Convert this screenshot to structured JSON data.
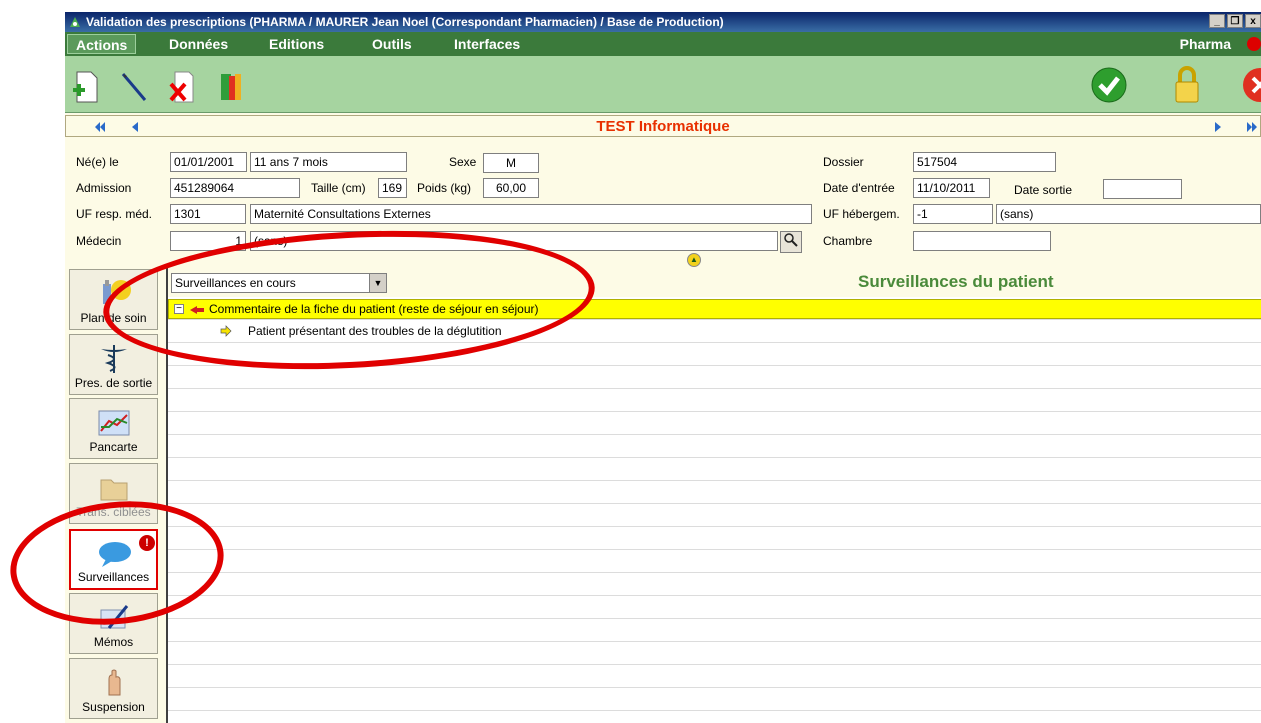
{
  "window": {
    "title": "Validation des prescriptions (PHARMA / MAURER Jean Noel (Correspondant Pharmacien) / Base de Production)",
    "buttons": {
      "minimize": "_",
      "maximize": "×",
      "close": "x"
    }
  },
  "menu": {
    "items": [
      {
        "label": "Actions",
        "active": true
      },
      {
        "label": "Données"
      },
      {
        "label": "Editions"
      },
      {
        "label": "Outils"
      },
      {
        "label": "Interfaces"
      }
    ],
    "user": "Pharma"
  },
  "toolbar": {
    "left_icons": [
      "add-document-icon",
      "edit-icon",
      "delete-icon",
      "book-icon"
    ],
    "right_icons": [
      "validate-check-icon",
      "lock-icon",
      "cancel-x-icon"
    ]
  },
  "patient": {
    "name": "TEST  Informatique",
    "fields": {
      "birth_label": "Né(e) le",
      "birth_value": "01/01/2001",
      "age_value": "11 ans 7 mois",
      "sex_label": "Sexe",
      "sex_value": "M",
      "admission_label": "Admission",
      "admission_value": "451289064",
      "height_label": "Taille (cm)",
      "height_value": "169",
      "weight_label": "Poids (kg)",
      "weight_value": "60,00",
      "uf_label": "UF resp. méd.",
      "uf_code": "1301",
      "uf_name": "Maternité Consultations Externes",
      "doctor_label": "Médecin",
      "doctor_code": "1",
      "doctor_name": "(sans)",
      "dossier_label": "Dossier",
      "dossier_value": "517504",
      "entry_label": "Date d'entrée",
      "entry_value": "11/10/2011",
      "exit_label": "Date sortie",
      "exit_value": "",
      "uf_heb_label": "UF hébergem.",
      "uf_heb_code": "-1",
      "uf_heb_name": "(sans)",
      "room_label": "Chambre",
      "room_value": ""
    }
  },
  "sidebar": {
    "items": [
      {
        "label": "Plan de soin",
        "icon": "care-plan-icon"
      },
      {
        "label": "Pres. de sortie",
        "icon": "caduceus-icon"
      },
      {
        "label": "Pancarte",
        "icon": "chart-icon"
      },
      {
        "label": "Trans. ciblées",
        "icon": "folder-icon"
      },
      {
        "label": "Surveillances",
        "icon": "speech-bubble-icon",
        "badge": "!"
      },
      {
        "label": "Mémos",
        "icon": "memo-pen-icon"
      },
      {
        "label": "Suspension",
        "icon": "hand-stop-icon"
      }
    ]
  },
  "surveillances": {
    "filter_value": "Surveillances en cours",
    "title": "Surveillances du patient",
    "rows": [
      {
        "text": "Commentaire de la fiche du patient (reste de séjour en séjour)"
      },
      {
        "text": "Patient présentant des troubles de la déglutition"
      }
    ]
  },
  "colors": {
    "title_bg": "#0a246a",
    "menu_bg": "#3b7a3b",
    "toolbar_bg": "#a6d4a0",
    "patient_name": "#e83000",
    "highlight_row": "#ffff00",
    "annotation": "#e00000"
  }
}
